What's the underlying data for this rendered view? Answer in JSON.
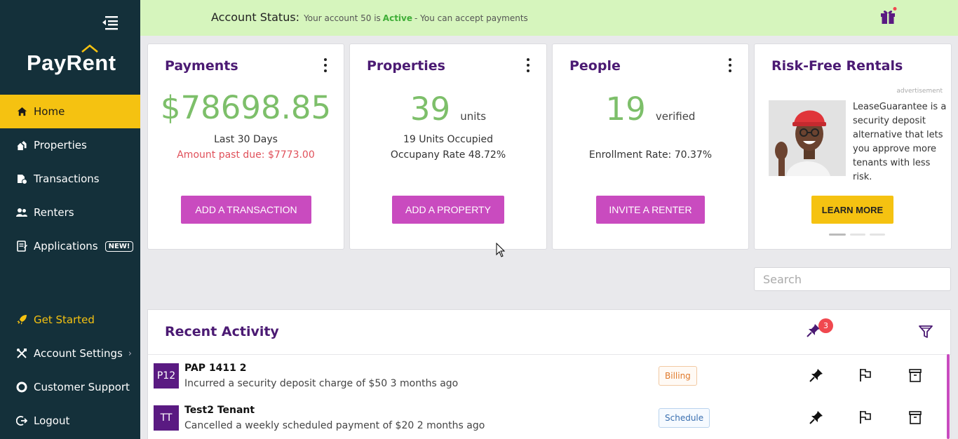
{
  "brand": {
    "logo_text_a": "PayR",
    "logo_text_e": "e",
    "logo_text_b": "nt"
  },
  "sidebar": {
    "items": [
      {
        "label": "Home",
        "icon": "home-icon",
        "active": true
      },
      {
        "label": "Properties",
        "icon": "properties-icon"
      },
      {
        "label": "Transactions",
        "icon": "transactions-icon"
      },
      {
        "label": "Renters",
        "icon": "renters-icon"
      },
      {
        "label": "Applications",
        "icon": "applications-icon",
        "badge": "NEW!"
      }
    ],
    "bottom": [
      {
        "label": "Get Started",
        "icon": "rocket-icon"
      },
      {
        "label": "Account Settings",
        "icon": "settings-icon"
      },
      {
        "label": "Customer Support",
        "icon": "support-icon"
      },
      {
        "label": "Logout",
        "icon": "logout-icon"
      }
    ]
  },
  "status": {
    "label": "Account Status:",
    "msg_pre": "Your account 50 is",
    "state": "Active",
    "msg_post": "- You can accept payments"
  },
  "cards": {
    "payments": {
      "title": "Payments",
      "amount": "$78698.85",
      "period": "Last 30 Days",
      "past_due": "Amount past due: $7773.00",
      "button": "ADD A TRANSACTION"
    },
    "properties": {
      "title": "Properties",
      "count": "39",
      "unit": "units",
      "occupied": "19 Units Occupied",
      "rate": "Occupany Rate 48.72%",
      "button": "ADD A PROPERTY"
    },
    "people": {
      "title": "People",
      "count": "19",
      "unit": "verified",
      "rate": "Enrollment Rate: 70.37%",
      "button": "INVITE A RENTER"
    },
    "ad": {
      "title": "Risk-Free Rentals",
      "label": "advertisement",
      "text": "LeaseGuarantee is a security deposit alternative that lets you approve more tenants with less risk.",
      "button": "LEARN MORE"
    }
  },
  "search": {
    "placeholder": "Search"
  },
  "activity": {
    "title": "Recent Activity",
    "pinned_count": "3",
    "rows": [
      {
        "initials": "P12",
        "name": "PAP 1411 2",
        "desc": "Incurred a security deposit charge of $50 3 months ago",
        "tag": "Billing"
      },
      {
        "initials": "TT",
        "name": "Test2 Tenant",
        "desc": "Cancelled a weekly scheduled payment of $20 2 months ago",
        "tag": "Schedule"
      }
    ]
  },
  "colors": {
    "sidebar": "#14303a",
    "accent": "#f5c211",
    "primary": "#4b1a73",
    "button": "#c94bbf",
    "positive": "#7dbf6a",
    "status_bg": "#d6f5bd"
  }
}
